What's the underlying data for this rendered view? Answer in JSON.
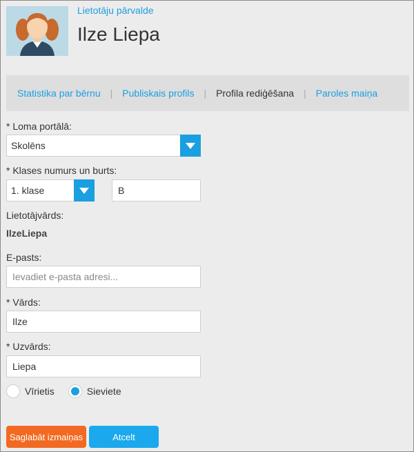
{
  "header": {
    "breadcrumb": "Lietotāju pārvalde",
    "title": "Ilze Liepa",
    "avatar_icon": "user-avatar-girl-icon"
  },
  "tabs": [
    {
      "label": "Statistika par bērnu",
      "active": false
    },
    {
      "label": "Publiskais profils",
      "active": false
    },
    {
      "label": "Profila rediģēšana",
      "active": true
    },
    {
      "label": "Paroles maiņa",
      "active": false
    }
  ],
  "form": {
    "role": {
      "label": "* Loma portālā:",
      "value": "Skolēns"
    },
    "class": {
      "label": "* Klases numurs un burts:",
      "number_value": "1. klase",
      "letter_value": "B"
    },
    "username": {
      "label": "Lietotājvārds:",
      "value": "IlzeLiepa"
    },
    "email": {
      "label": "E-pasts:",
      "value": "",
      "placeholder": "Ievadiet e-pasta adresi..."
    },
    "first_name": {
      "label": "* Vārds:",
      "value": "Ilze"
    },
    "last_name": {
      "label": "* Uzvārds:",
      "value": "Liepa"
    },
    "gender": {
      "male_label": "Vīrietis",
      "female_label": "Sieviete",
      "selected": "female"
    }
  },
  "buttons": {
    "save_label": "Saglabāt izmaiņas",
    "cancel_label": "Atcelt"
  },
  "colors": {
    "accent": "#1a9fe0",
    "save": "#f26a21",
    "cancel": "#1ba8ec"
  }
}
